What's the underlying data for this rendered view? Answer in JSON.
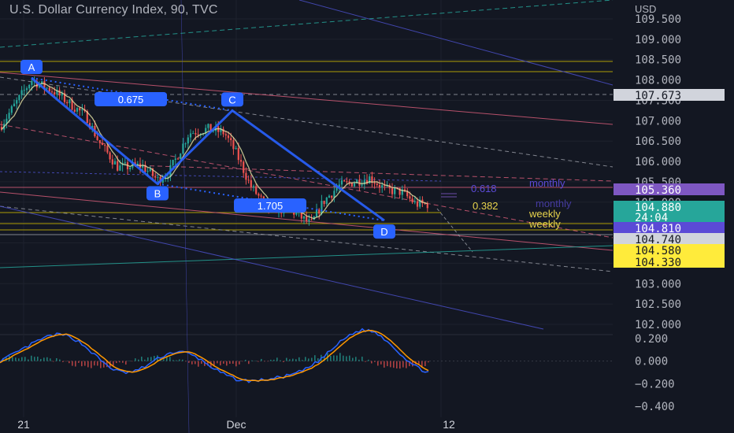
{
  "chart_data": {
    "type": "candlestick",
    "title": "U.S. Dollar Currency Index, 90, TVC",
    "currency": "USD",
    "price_axis": {
      "ticks": [
        "109.500",
        "109.000",
        "108.500",
        "108.000",
        "107.500",
        "107.000",
        "106.500",
        "106.000",
        "105.500",
        "105.000",
        "104.500",
        "104.000",
        "103.500",
        "103.000",
        "102.500",
        "102.000"
      ],
      "range": [
        102.0,
        109.5
      ]
    },
    "time_axis": {
      "ticks": [
        "21",
        "Dec",
        "12"
      ]
    },
    "price_labels": [
      {
        "value": "107.673",
        "color": "#d1d4dc",
        "text_color": "#131722"
      },
      {
        "value": "105.360",
        "color": "#7e57c2",
        "text_color": "#ffffff"
      },
      {
        "value": "104.880",
        "color": "#26a69a",
        "text_color": "#ffffff",
        "sub": "24:04"
      },
      {
        "value": "104.810",
        "color": "#5b4ad6",
        "text_color": "#ffffff"
      },
      {
        "value": "104.740",
        "color": "#d1d4dc",
        "text_color": "#131722"
      },
      {
        "value": "104.580",
        "color": "#ffeb3b",
        "text_color": "#131722"
      },
      {
        "value": "104.330",
        "color": "#ffeb3b",
        "text_color": "#131722"
      }
    ],
    "harmonic_pattern": {
      "points": [
        {
          "label": "A",
          "price": 108.05
        },
        {
          "label": "B",
          "price": 105.45
        },
        {
          "label": "C",
          "price": 107.25
        },
        {
          "label": "D",
          "price": 104.55
        }
      ],
      "ratios": [
        "0.675",
        "1.705"
      ]
    },
    "annotations": [
      "0.382",
      "weekly",
      "weekly",
      "monthly",
      "monthly",
      "0.618"
    ],
    "oscillator": {
      "ticks": [
        "0.200",
        "0.000",
        "−0.200",
        "−0.400"
      ],
      "range": [
        -0.5,
        0.25
      ]
    }
  }
}
